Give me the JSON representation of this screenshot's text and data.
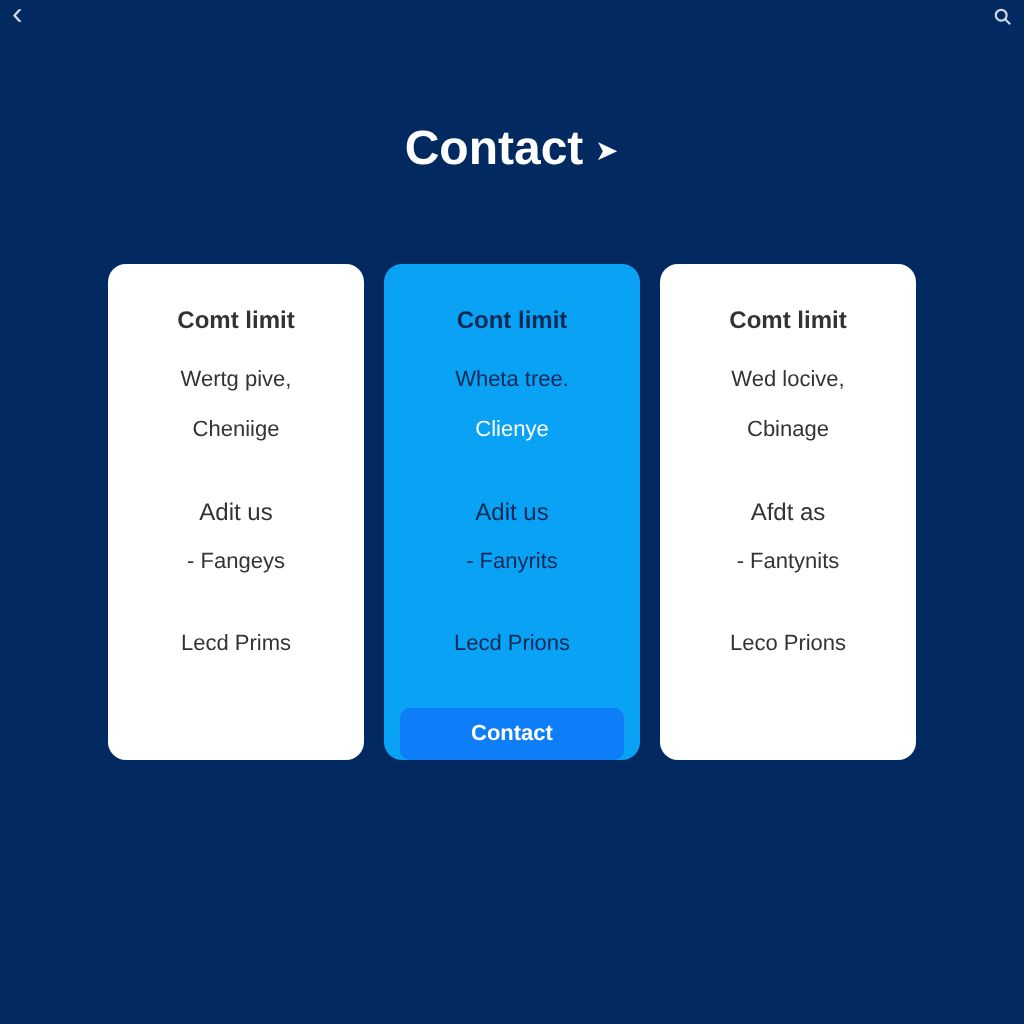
{
  "header": {
    "back": "‹",
    "title": "Contact",
    "title_arrow": "➤"
  },
  "plans": [
    {
      "title": "Comt limit",
      "line_1": "Wertg pive,",
      "line_2": "Cheniige",
      "heading": "Adit us",
      "item": "- Fangeys",
      "footer": "Lecd Prims",
      "selected": false
    },
    {
      "title": "Cont limit",
      "line_1": "Wheta tree.",
      "line_2": "Clienye",
      "heading": "Adit us",
      "item": "- Fanyrits",
      "footer": "Lecd Prions",
      "selected": true,
      "button": "Contact"
    },
    {
      "title": "Comt limit",
      "line_1": "Wed locive,",
      "line_2": "Cbinage",
      "heading": "Afdt as",
      "item": "- Fantynits",
      "footer": "Leco Prions",
      "selected": false
    }
  ]
}
